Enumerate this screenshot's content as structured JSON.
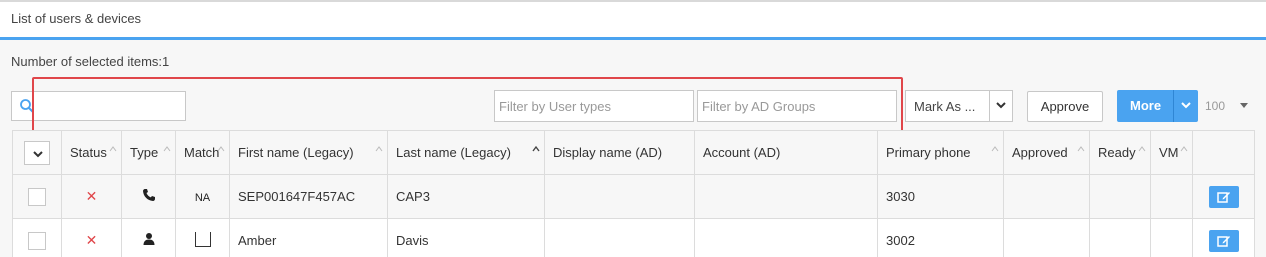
{
  "header": {
    "title": "List of users & devices"
  },
  "selection": {
    "text": "Number of selected items:1"
  },
  "toolbar": {
    "search_value": "",
    "filter_user_types_placeholder": "Filter by User types",
    "filter_ad_groups_placeholder": "Filter by AD Groups",
    "mark_as_label": "Mark As ...",
    "approve_label": "Approve",
    "more_label": "More",
    "page_size": "100"
  },
  "table": {
    "columns": [
      "Status",
      "Type",
      "Match",
      "First name (Legacy)",
      "Last name (Legacy)",
      "Display name (AD)",
      "Account (AD)",
      "Primary phone",
      "Approved",
      "Ready",
      "VM"
    ],
    "rows": [
      {
        "selected": false,
        "status": "✕",
        "type_icon": "phone-icon",
        "match": "NA",
        "first_name": "SEP001647F457AC",
        "last_name": "CAP3",
        "display_name": "",
        "account": "",
        "primary_phone": "3030",
        "approved": "",
        "ready": "",
        "vm": ""
      },
      {
        "selected": false,
        "status": "✕",
        "type_icon": "user-icon",
        "match": "",
        "first_name": "Amber",
        "last_name": "Davis",
        "display_name": "",
        "account": "",
        "primary_phone": "3002",
        "approved": "",
        "ready": "",
        "vm": ""
      }
    ]
  },
  "colors": {
    "accent": "#4aa3f0",
    "highlight": "#e0464a",
    "status_error": "#e0464a"
  }
}
